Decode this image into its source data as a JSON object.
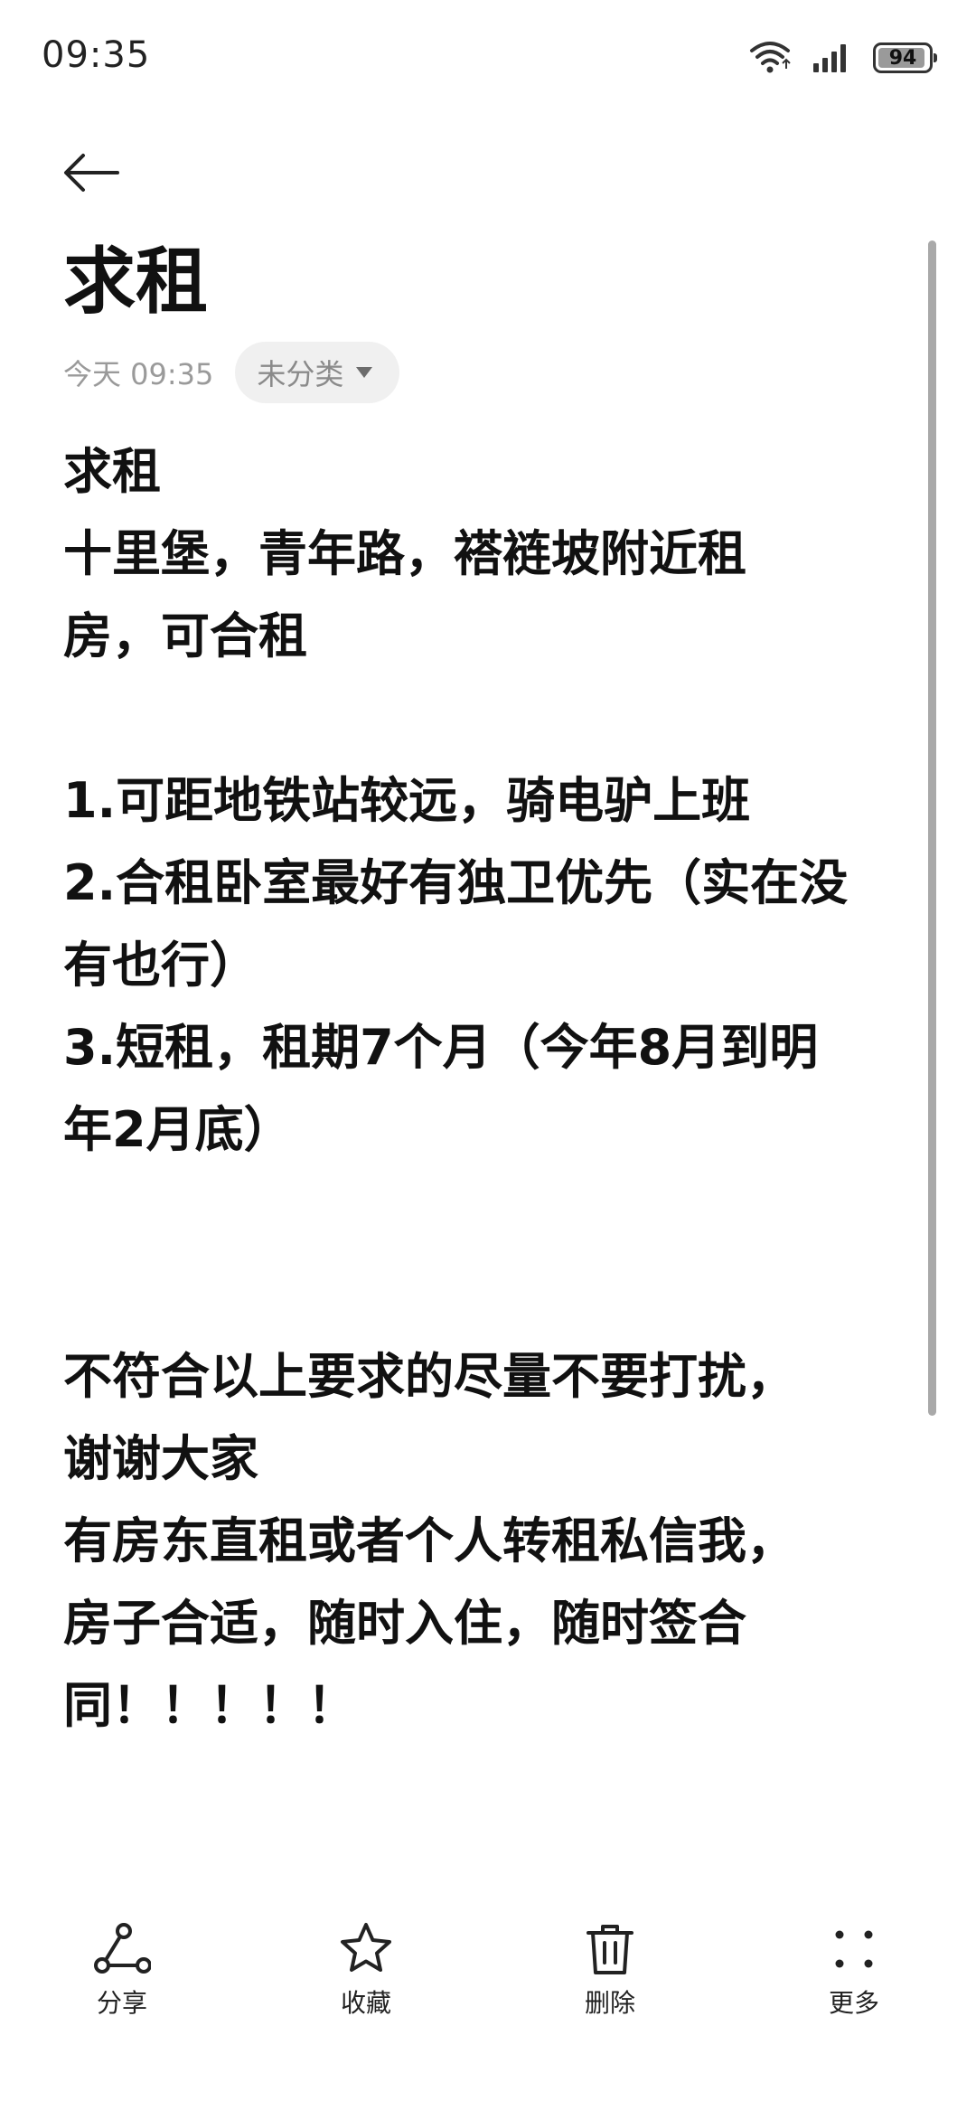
{
  "status_bar": {
    "time": "09:35",
    "battery_level": "94",
    "battery_percent": 94,
    "icons": [
      "wifi-icon",
      "signal-icon",
      "battery-icon"
    ]
  },
  "header": {
    "back_icon": "arrow-left-icon"
  },
  "note": {
    "title": "求租",
    "date": "今天 09:35",
    "category": "未分类",
    "body": "求租\n十里堡，青年路，褡裢坡附近租\n房，可合租\n\n1.可距地铁站较远，骑电驴上班\n2.合租卧室最好有独卫优先（实在没\n有也行）\n3.短租，租期7个月（今年8月到明\n年2月底）\n\n\n不符合以上要求的尽量不要打扰，\n谢谢大家\n有房东直租或者个人转租私信我，\n房子合适，随时入住，随时签合\n同！！！！！"
  },
  "toolbar": {
    "share_label": "分享",
    "favorite_label": "收藏",
    "delete_label": "删除",
    "more_label": "更多"
  }
}
